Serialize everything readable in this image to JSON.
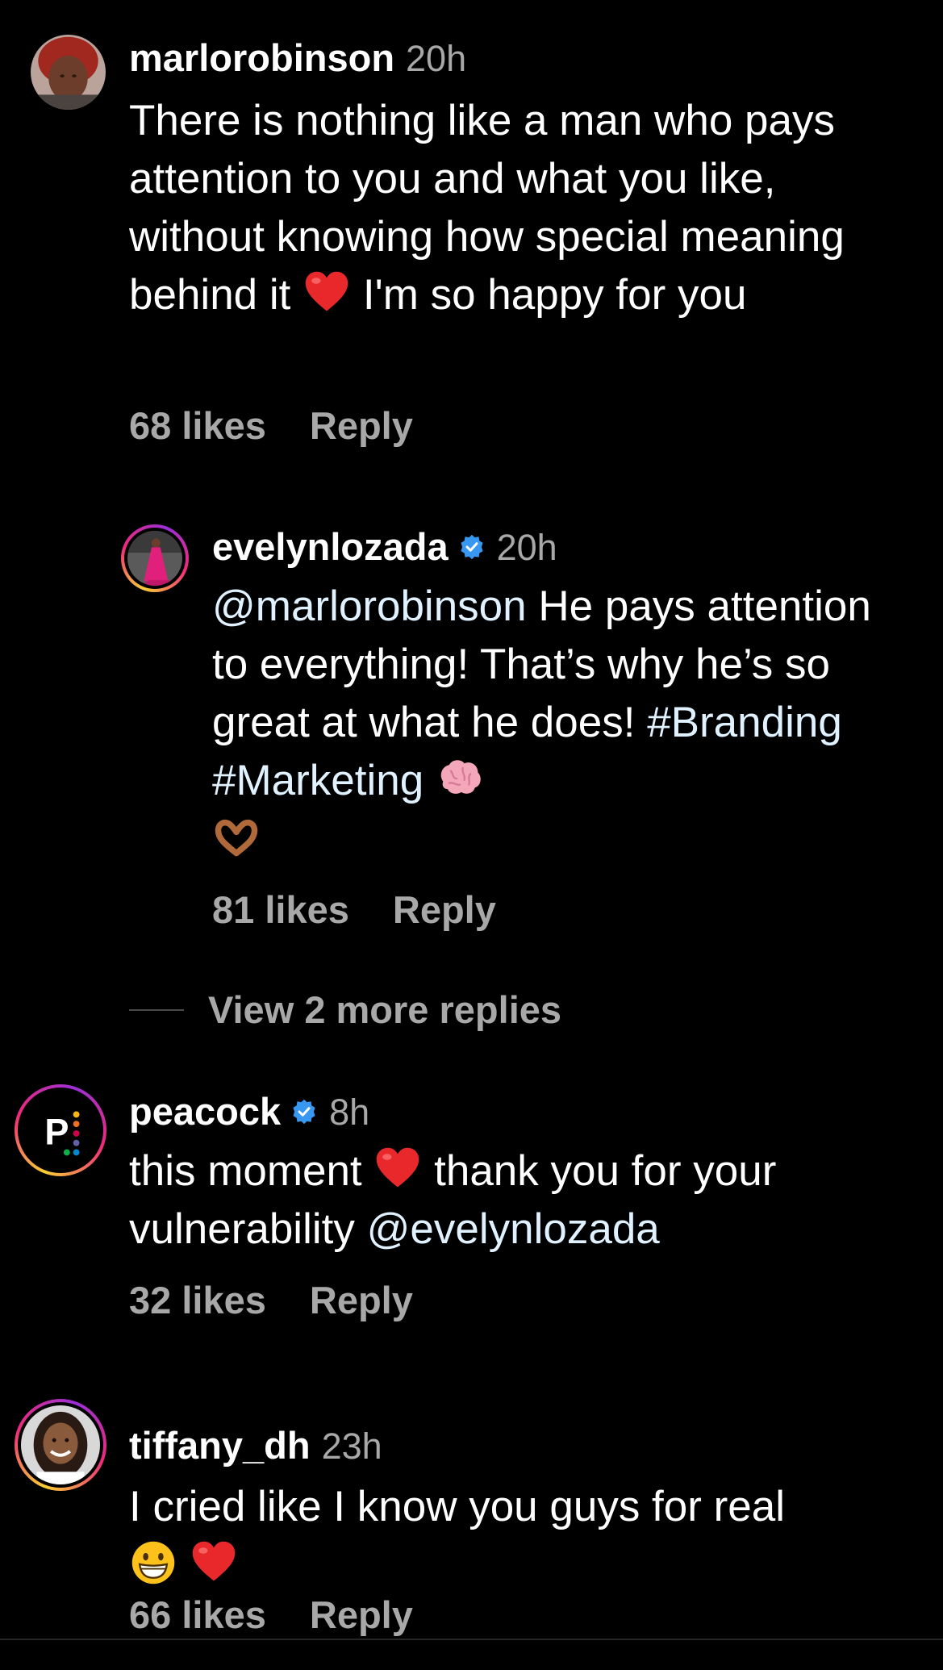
{
  "comments": [
    {
      "username": "marlorobinson",
      "time": "20h",
      "avatar": "avatar-photo-woman-red-hair",
      "text_parts": [
        "There is nothing like a man who pays attention to you and what you like, without knowing how special meaning behind it ",
        "heart-emoji",
        " I'm so happy for you"
      ],
      "text_a": "There is nothing like a man who pays attention to you and what you like, without knowing how special meaning behind it",
      "text_b": "I'm so happy for you",
      "likes": "68 likes",
      "reply": "Reply"
    },
    {
      "username": "evelynlozada",
      "verified": true,
      "time": "20h",
      "avatar": "avatar-photo-woman-pink-dress",
      "mention": "@marlorobinson",
      "text": " He pays attention to everything! That’s why he’s so great at what he does! ",
      "tag1": "#Branding",
      "tag2": "#Marketing",
      "emojis": [
        "brain-emoji",
        "heart-hands-emoji"
      ],
      "likes": "81 likes",
      "reply": "Reply"
    },
    {
      "username": "peacock",
      "verified": true,
      "time": "8h",
      "avatar": "peacock-logo",
      "text_a": "this moment",
      "text_b": " thank you for your vulnerability ",
      "mention": "@evelynlozada",
      "likes": "32 likes",
      "reply": "Reply"
    },
    {
      "username": "tiffany_dh",
      "time": "23h",
      "avatar": "avatar-photo-woman-smiling",
      "text": "I cried like I know you guys for real",
      "emojis": [
        "grinning-face-emoji",
        "heart-emoji"
      ],
      "likes": "66 likes",
      "reply": "Reply"
    }
  ],
  "view_more_replies": "View 2 more replies",
  "colors": {
    "background": "#000000",
    "text": "#ffffff",
    "secondary": "#a8a8a8",
    "mention": "#e0f1ff",
    "verified": "#3897f0"
  }
}
